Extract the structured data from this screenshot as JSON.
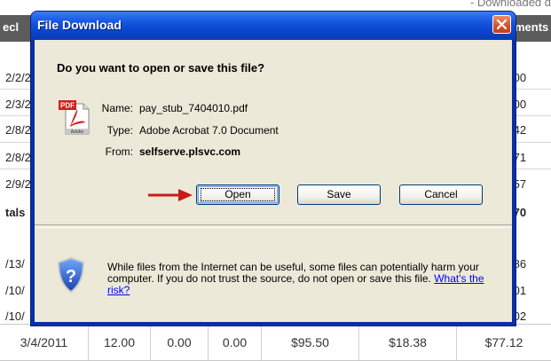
{
  "background": {
    "top_note": "- Downloaded d",
    "header": {
      "left": "ecl",
      "right": "ments"
    },
    "rows": [
      {
        "left": "2/2/2",
        "right": ".00"
      },
      {
        "left": "2/3/2",
        "right": ".00"
      },
      {
        "left": "2/8/2",
        "right": ".42"
      },
      {
        "left": "2/8/2",
        "right": ".71"
      },
      {
        "left": "2/9/2",
        "right": ".57"
      },
      {
        "left": "tals",
        "right": ".70"
      },
      {
        "left": "/13/",
        "right": ".86"
      },
      {
        "left": "/10/",
        "right": ".01"
      },
      {
        "left": "/10/",
        "right": ".02"
      }
    ],
    "last_row": [
      "3/4/2011",
      "12.00",
      "0.00",
      "0.00",
      "$95.50",
      "$18.38",
      "$77.12"
    ]
  },
  "dialog": {
    "title": "File Download",
    "question": "Do you want to open or save this file?",
    "file": {
      "name_label": "Name:",
      "name_value": "pay_stub_7404010.pdf",
      "type_label": "Type:",
      "type_value": "Adobe Acrobat 7.0 Document",
      "from_label": "From:",
      "from_value": "selfserve.plsvc.com"
    },
    "buttons": {
      "open": "Open",
      "save": "Save",
      "cancel": "Cancel"
    },
    "warning_text": "While files from the Internet can be useful, some files can potentially harm your computer. If you do not trust the source, do not open or save this file.",
    "risk_link": "What's the risk?",
    "pdf_icon_text": "PDF",
    "adobe_text": "Adobe"
  },
  "colors": {
    "title_bar": "#0a44cc",
    "dialog_face": "#ece9d8",
    "close_button": "#d4502a",
    "arrow": "#cc1a1a",
    "link": "#0000ff"
  },
  "icons": [
    "close-icon",
    "pdf-file-icon",
    "shield-warning-icon",
    "red-arrow-annotation"
  ]
}
